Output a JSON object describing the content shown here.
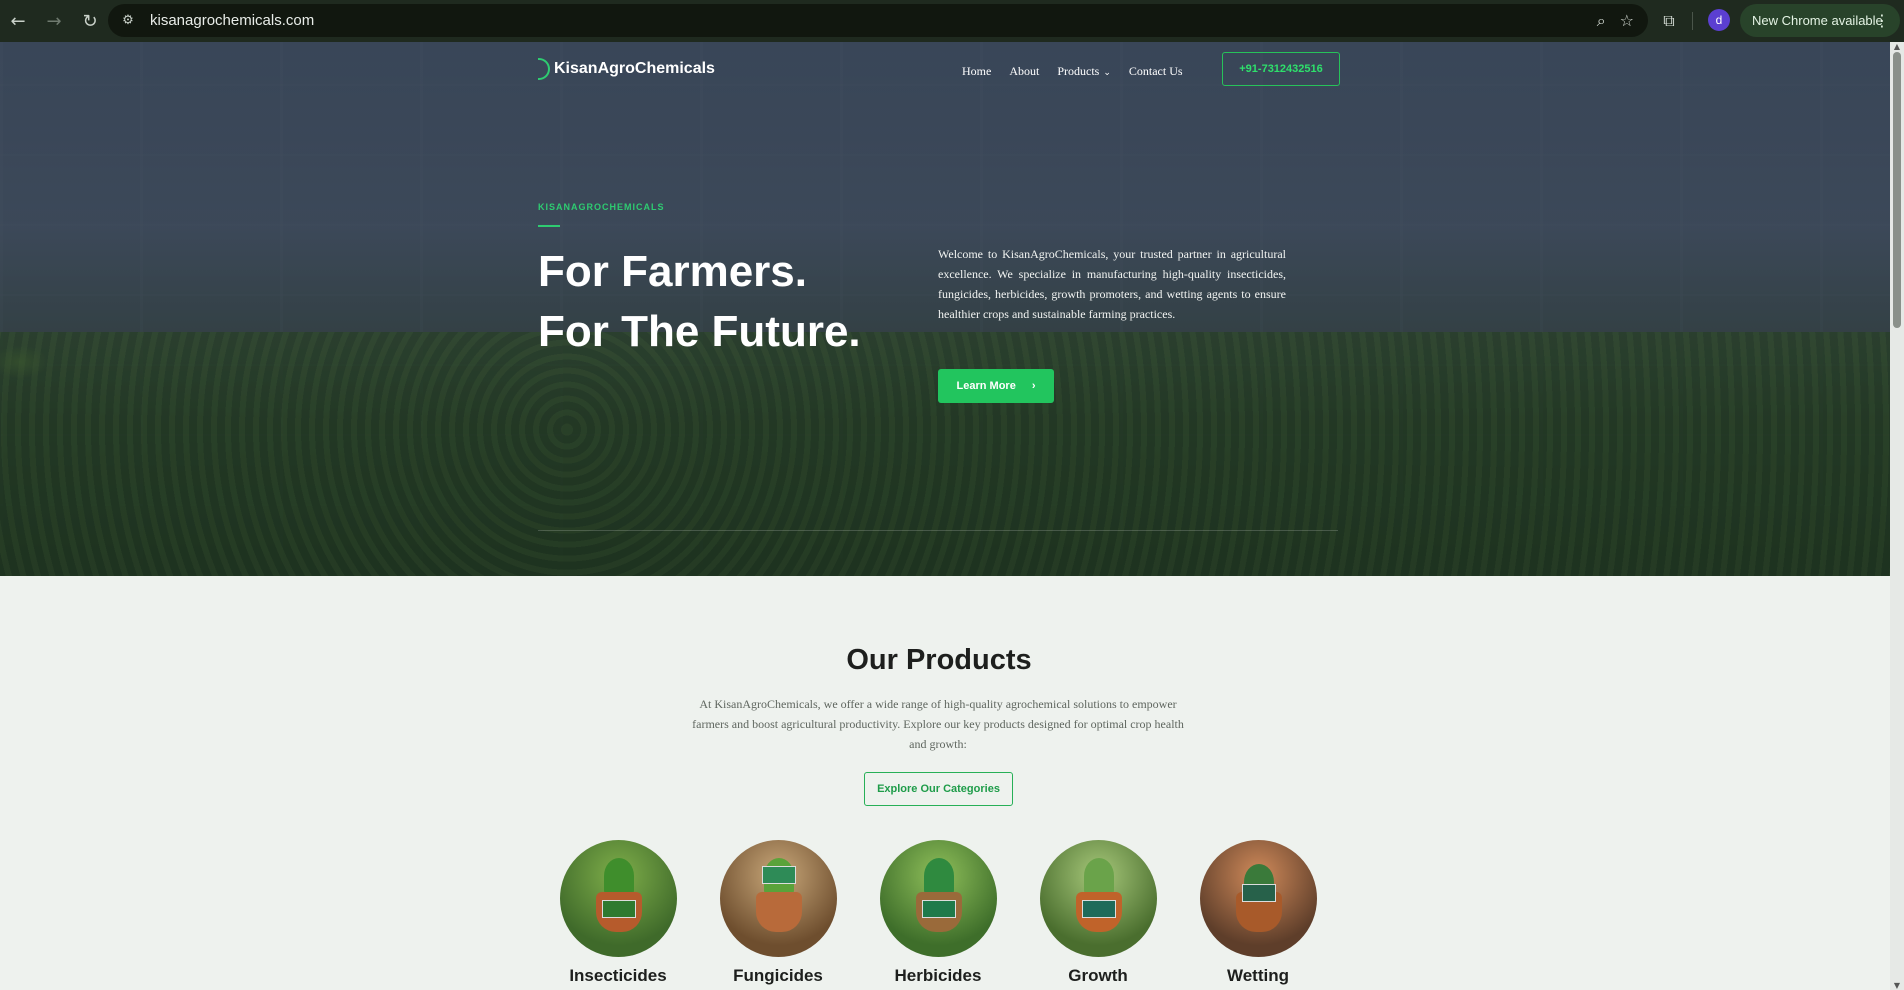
{
  "browser": {
    "url": "kisanagrochemicals.com",
    "profile_initial": "d",
    "update_label": "New Chrome available",
    "icons": [
      "back-arrow-icon",
      "forward-arrow-icon",
      "reload-icon",
      "site-info-icon",
      "zoom-icon",
      "bookmark-star-icon",
      "extensions-icon",
      "menu-dots-icon"
    ]
  },
  "site": {
    "logo_text": "KisanAgroChemicals",
    "nav": [
      "Home",
      "About",
      "Products",
      "Contact Us"
    ],
    "phone": "+91-7312432516"
  },
  "hero": {
    "eyebrow": "KISANAGROCHEMICALS",
    "headline_line1": "For Farmers.",
    "headline_line2": "For The Future.",
    "body": "Welcome to KisanAgroChemicals, your trusted partner in agricultural excellence. We specialize in manufacturing high-quality insecticides, fungicides, herbicides, growth promoters, and wetting agents to ensure healthier crops and sustainable farming practices.",
    "cta": "Learn More"
  },
  "products": {
    "title": "Our Products",
    "description": "At KisanAgroChemicals, we offer a wide range of high-quality agrochemical solutions to empower farmers and boost agricultural productivity. Explore our key products designed for optimal crop health and growth:",
    "cta": "Explore Our Categories",
    "categories": [
      "Insecticides",
      "Fungicides",
      "Herbicides",
      "Growth",
      "Wetting"
    ]
  },
  "colors": {
    "accent_green": "#22c55e",
    "text_dark": "#1d1f1d",
    "page_bg": "#eef2ee",
    "chrome_bg": "#1f2a1f"
  }
}
